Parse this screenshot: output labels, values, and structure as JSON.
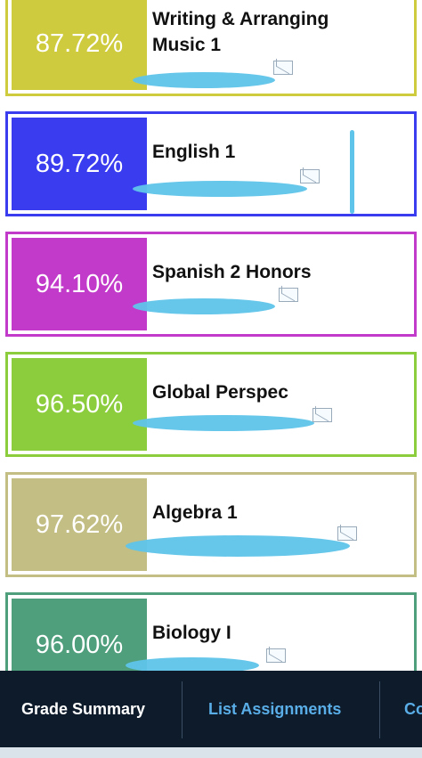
{
  "colors": {
    "writing": "#cfcb3f",
    "english": "#3a3cf0",
    "spanish": "#c13ac9",
    "global": "#8ccd3d",
    "algebra": "#c3be84",
    "biology": "#4f9f7d",
    "tabbar_bg": "#0d1b2a",
    "tab_active": "#ffffff",
    "tab_inactive": "#5aaee8"
  },
  "courses": [
    {
      "grade": "87.72%",
      "name": "Writing & Arranging Music 1"
    },
    {
      "grade": "89.72%",
      "name": "English 1"
    },
    {
      "grade": "94.10%",
      "name": "Spanish 2 Honors"
    },
    {
      "grade": "96.50%",
      "name": "Global Perspec"
    },
    {
      "grade": "97.62%",
      "name": "Algebra 1"
    },
    {
      "grade": "96.00%",
      "name": "Biology I"
    }
  ],
  "tabs": [
    {
      "label": "Grade Summary"
    },
    {
      "label": "List Assignments"
    },
    {
      "label": "Co"
    }
  ],
  "icons": {
    "email": "mail-icon"
  }
}
